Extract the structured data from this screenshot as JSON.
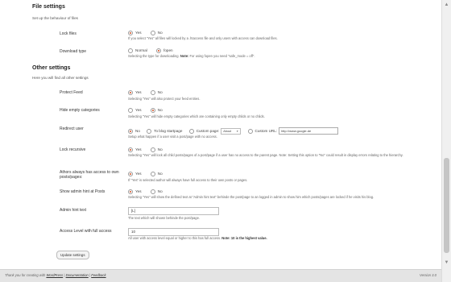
{
  "file_settings": {
    "heading": "File settings",
    "intro": "Set up the behaviour of files",
    "lock_files": {
      "label": "Lock files",
      "options": [
        "Yes",
        "No"
      ],
      "selected": "Yes",
      "desc": "If you select \"Yes\" all files will locked by a .htaccess file and only users with access can download files."
    },
    "download_type": {
      "label": "Download type",
      "options": [
        "Normal",
        "fopen"
      ],
      "selected": "fopen",
      "desc_lead": "Selecting the type for downloading.",
      "desc_note": "Note:",
      "desc_tail": "For using fopen you need \"safe_mode = off\"."
    }
  },
  "other_settings": {
    "heading": "Other settings",
    "intro": "Here you will find all other settings",
    "protect_feed": {
      "label": "Protect Feed",
      "options": [
        "Yes",
        "No"
      ],
      "selected": "Yes",
      "desc": "Selecting \"Yes\" will also protect your feed entries."
    },
    "hide_empty": {
      "label": "Hide empty categories",
      "options": [
        "Yes",
        "No"
      ],
      "selected": "No",
      "desc": "Selecting \"Yes\" will hide empty categories which are containing only empty childs or no childs."
    },
    "redirect_user": {
      "label": "Redirect user",
      "options": [
        "No",
        "To blog startpage",
        "Custom page:",
        "Custom URL:"
      ],
      "selected": "No",
      "page_select": "About",
      "url_value": "http://www.google.de",
      "desc": "Setup what happen if a user visit a post/page with no access."
    },
    "lock_recursive": {
      "label": "Lock recursive",
      "options": [
        "Yes",
        "No"
      ],
      "selected": "Yes",
      "desc": "Selecting \"Yes\" will lock all child posts/pages of a post/page if a user has no access to the parent page. Note: Setting this option to \"No\" could result in display errors relating to the hierarchy."
    },
    "authors_access": {
      "label": "Athors always has access to own posts/pages:",
      "options": [
        "Yes",
        "No"
      ],
      "selected": "Yes",
      "desc": "If \"Yes\" is selected author will always have full access to their own posts or pages."
    },
    "show_admin_hint": {
      "label": "Show admin hint at Posts",
      "options": [
        "Yes",
        "No"
      ],
      "selected": "Yes",
      "desc": "Selecting \"Yes\" will show the defined text at \"Admin hint text\" behinde the post/page to an logged in admin to show him which posts/pages are locked if he visits his blog."
    },
    "admin_hint_text": {
      "label": "Admin hint text",
      "value": "[L]",
      "desc": "The text which will shown behinde the post/page."
    },
    "access_level": {
      "label": "Access Level with full access",
      "value": "10",
      "desc_lead": "All user with access level equal or higher to this has full access.",
      "desc_note": "Note: 10 is the highest value."
    }
  },
  "update_button": "Update settings",
  "footer": {
    "lead": "Thank you for creating with",
    "wordpress": "WordPress",
    "sep1": " | ",
    "documentation": "Documentation",
    "sep2": " | ",
    "feedback": "Feedback",
    "version": "Version 3.0"
  },
  "colors": {
    "radio_selected": "#d54e21",
    "footer_bg": "#e4e4e4"
  }
}
